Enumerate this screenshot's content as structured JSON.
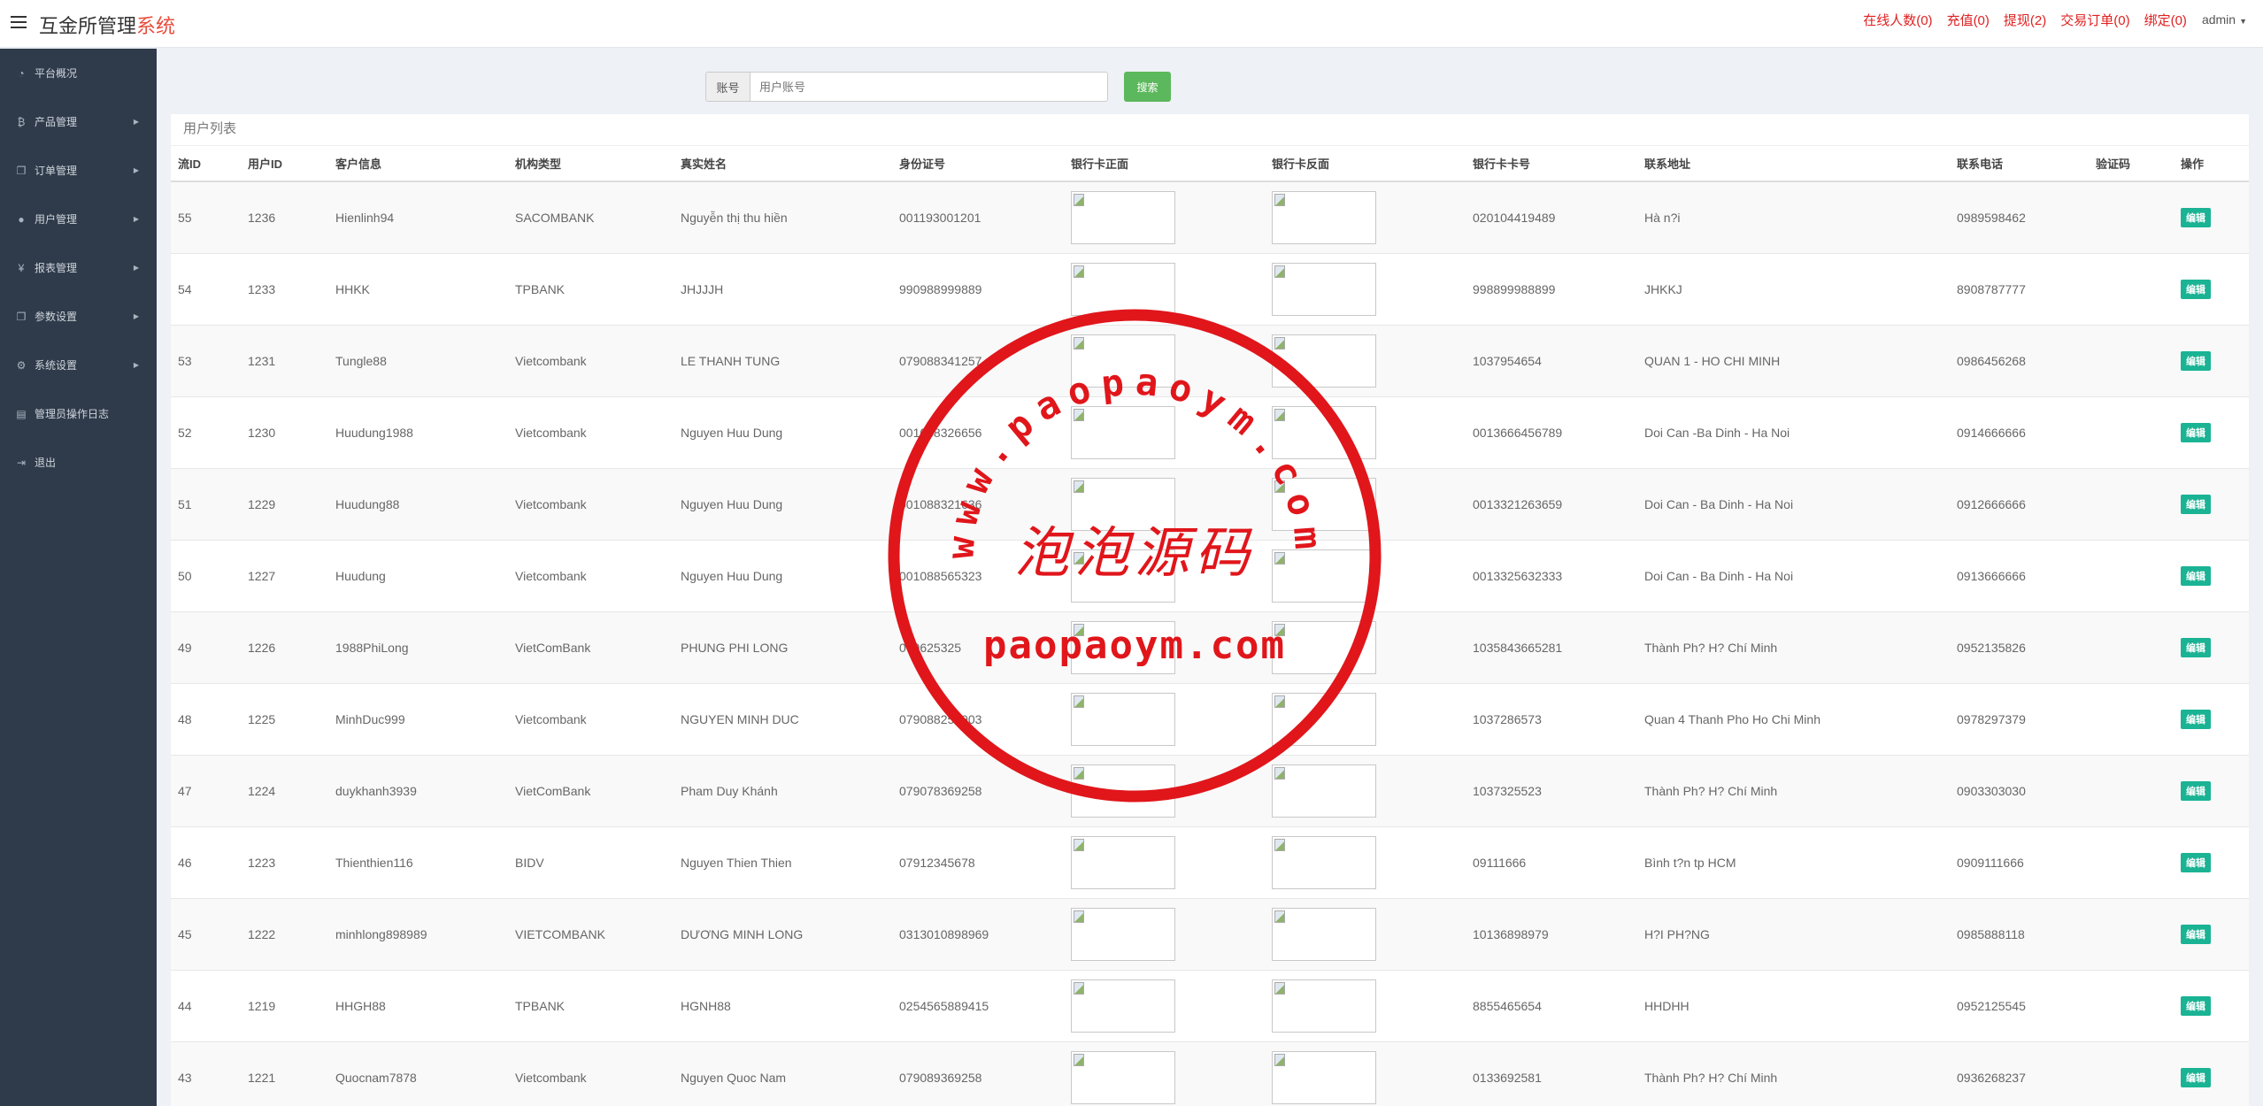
{
  "header": {
    "brand_main": "互金所管理",
    "brand_accent": "系统",
    "nav": [
      {
        "label": "在线人数(0)",
        "name": "online-users-link"
      },
      {
        "label": "充值(0)",
        "name": "recharge-link"
      },
      {
        "label": "提现(2)",
        "name": "withdraw-link"
      },
      {
        "label": "交易订单(0)",
        "name": "trade-orders-link"
      },
      {
        "label": "绑定(0)",
        "name": "bind-link"
      }
    ],
    "user": "admin"
  },
  "sidebar": {
    "items": [
      {
        "label": "平台概况",
        "icon": "dashboard-icon",
        "glyph": "◔",
        "arrow": false,
        "name": "platform-overview"
      },
      {
        "label": "产品管理",
        "icon": "bitcoin-icon",
        "glyph": "₿",
        "arrow": true,
        "name": "product-management"
      },
      {
        "label": "订单管理",
        "icon": "files-icon",
        "glyph": "❐",
        "arrow": true,
        "name": "order-management"
      },
      {
        "label": "用户管理",
        "icon": "user-icon",
        "glyph": "●",
        "arrow": true,
        "name": "user-management"
      },
      {
        "label": "报表管理",
        "icon": "yen-icon",
        "glyph": "¥",
        "arrow": true,
        "name": "report-management"
      },
      {
        "label": "参数设置",
        "icon": "files-icon",
        "glyph": "❐",
        "arrow": true,
        "name": "parameter-settings"
      },
      {
        "label": "系统设置",
        "icon": "gears-icon",
        "glyph": "⚙",
        "arrow": true,
        "name": "system-settings"
      },
      {
        "label": "管理员操作日志",
        "icon": "file-icon",
        "glyph": "▤",
        "arrow": false,
        "name": "admin-log"
      },
      {
        "label": "退出",
        "icon": "sign-out-icon",
        "glyph": "⇥",
        "arrow": false,
        "name": "logout"
      }
    ]
  },
  "search": {
    "addon_label": "账号",
    "placeholder": "用户账号",
    "value": "",
    "button_label": "搜索"
  },
  "panel": {
    "title": "用户列表",
    "columns": [
      "流ID",
      "用户ID",
      "客户信息",
      "机构类型",
      "真实姓名",
      "身份证号",
      "银行卡正面",
      "银行卡反面",
      "银行卡卡号",
      "联系地址",
      "联系电话",
      "验证码",
      "操作"
    ],
    "edit_label": "编辑",
    "rows": [
      {
        "id": "55",
        "uid": "1236",
        "account": "Hienlinh94",
        "bank": "SACOMBANK",
        "name": "Nguyễn thị thu hiền",
        "idcard": "001193001201",
        "card_no": "020104419489",
        "address": "Hà n?i",
        "phone": "0989598462",
        "code": ""
      },
      {
        "id": "54",
        "uid": "1233",
        "account": "HHKK",
        "bank": "TPBANK",
        "name": "JHJJJH",
        "idcard": "990988999889",
        "card_no": "998899988899",
        "address": "JHKKJ",
        "phone": "8908787777",
        "code": ""
      },
      {
        "id": "53",
        "uid": "1231",
        "account": "Tungle88",
        "bank": "Vietcombank",
        "name": "LE THANH TUNG",
        "idcard": "079088341257",
        "card_no": "1037954654",
        "address": "QUAN 1 - HO CHI MINH",
        "phone": "0986456268",
        "code": ""
      },
      {
        "id": "52",
        "uid": "1230",
        "account": "Huudung1988",
        "bank": "Vietcombank",
        "name": "Nguyen Huu Dung",
        "idcard": "001088326656",
        "card_no": "0013666456789",
        "address": "Doi Can -Ba Dinh - Ha Noi",
        "phone": "0914666666",
        "code": ""
      },
      {
        "id": "51",
        "uid": "1229",
        "account": "Huudung88",
        "bank": "Vietcombank",
        "name": "Nguyen Huu Dung",
        "idcard": "001088321636",
        "card_no": "0013321263659",
        "address": "Doi Can - Ba Dinh - Ha Noi",
        "phone": "0912666666",
        "code": ""
      },
      {
        "id": "50",
        "uid": "1227",
        "account": "Huudung",
        "bank": "Vietcombank",
        "name": "Nguyen Huu Dung",
        "idcard": "001088565323",
        "card_no": "0013325632333",
        "address": "Doi Can - Ba Dinh - Ha Noi",
        "phone": "0913666666",
        "code": ""
      },
      {
        "id": "49",
        "uid": "1226",
        "account": "1988PhiLong",
        "bank": "VietComBank",
        "name": "PHUNG PHI LONG",
        "idcard": "079625325",
        "card_no": "1035843665281",
        "address": "Thành Ph? H? Chí Minh",
        "phone": "0952135826",
        "code": ""
      },
      {
        "id": "48",
        "uid": "1225",
        "account": "MinhDuc999",
        "bank": "Vietcombank",
        "name": "NGUYEN MINH DUC",
        "idcard": "079088256903",
        "card_no": "1037286573",
        "address": "Quan 4 Thanh Pho Ho Chi Minh",
        "phone": "0978297379",
        "code": ""
      },
      {
        "id": "47",
        "uid": "1224",
        "account": "duykhanh3939",
        "bank": "VietComBank",
        "name": "Pham Duy Khánh",
        "idcard": "079078369258",
        "card_no": "1037325523",
        "address": "Thành Ph? H? Chí Minh",
        "phone": "0903303030",
        "code": ""
      },
      {
        "id": "46",
        "uid": "1223",
        "account": "Thienthien116",
        "bank": "BIDV",
        "name": "Nguyen Thien Thien",
        "idcard": "07912345678",
        "card_no": "09111666",
        "address": "Bình t?n tp HCM",
        "phone": "0909111666",
        "code": ""
      },
      {
        "id": "45",
        "uid": "1222",
        "account": "minhlong898989",
        "bank": "VIETCOMBANK",
        "name": "DƯƠNG MINH LONG",
        "idcard": "0313010898969",
        "card_no": "10136898979",
        "address": "H?I PH?NG",
        "phone": "0985888118",
        "code": ""
      },
      {
        "id": "44",
        "uid": "1219",
        "account": "HHGH88",
        "bank": "TPBANK",
        "name": "HGNH88",
        "idcard": "0254565889415",
        "card_no": "8855465654",
        "address": "HHDHH",
        "phone": "0952125545",
        "code": ""
      },
      {
        "id": "43",
        "uid": "1221",
        "account": "Quocnam7878",
        "bank": "Vietcombank",
        "name": "Nguyen Quoc Nam",
        "idcard": "079089369258",
        "card_no": "0133692581",
        "address": "Thành Ph? H? Chí Minh",
        "phone": "0936268237",
        "code": ""
      }
    ]
  },
  "watermark": {
    "top_arc": "www.paopaoym.com",
    "center": "泡泡源码",
    "bottom": "paopaoym.com",
    "color": "#e0161b"
  }
}
